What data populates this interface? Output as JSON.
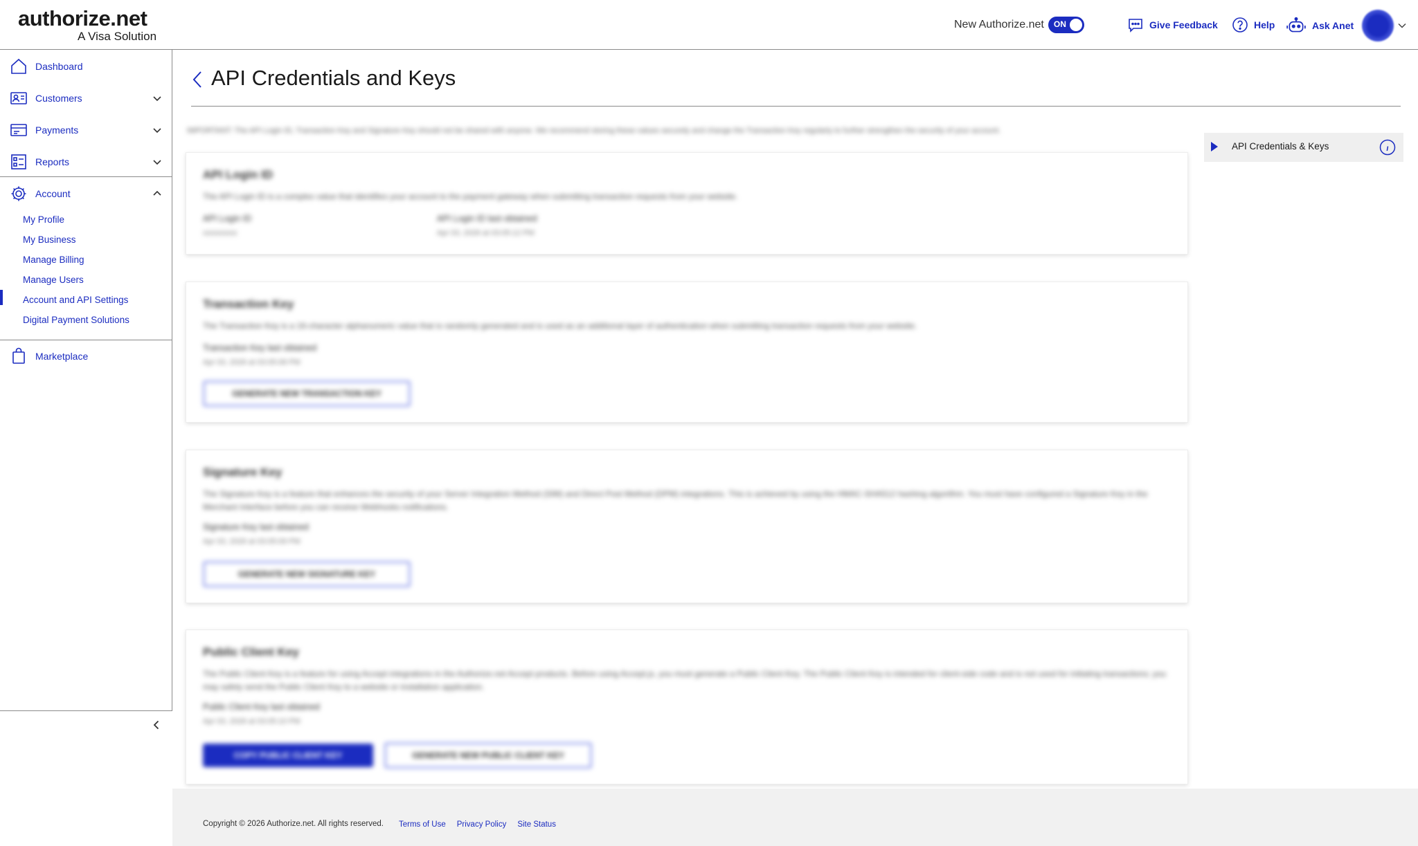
{
  "header": {
    "logo": "authorize.net",
    "logo_tagline": "A Visa Solution",
    "toggle_label": "New Authorize.net",
    "toggle_state": "ON",
    "give_feedback": "Give Feedback",
    "help": "Help",
    "ask_anet": "Ask Anet"
  },
  "sidebar": {
    "items": [
      {
        "label": "Dashboard",
        "icon": "home-icon"
      },
      {
        "label": "Customers",
        "icon": "customers-icon"
      },
      {
        "label": "Payments",
        "icon": "card-icon"
      },
      {
        "label": "Reports",
        "icon": "reports-icon"
      },
      {
        "label": "Account",
        "icon": "gear-icon"
      },
      {
        "label": "Marketplace",
        "icon": "bag-icon"
      }
    ],
    "account_sub": [
      "My Profile",
      "My Business",
      "Manage Billing",
      "Manage Users",
      "Account and API Settings",
      "Digital Payment Solutions"
    ],
    "active_sub": "Account and API Settings"
  },
  "page": {
    "title": "API Credentials and Keys",
    "notice": "IMPORTANT: The API Login ID, Transaction Key and Signature Key should not be shared with anyone. We recommend storing these values securely and change the Transaction Key regularly to further strengthen the security of your account.",
    "cards": [
      {
        "title": "API Login ID",
        "desc": "The API Login ID is a complex value that identifies your account to the payment gateway when submitting transaction requests from your website.",
        "label1": "API Login ID",
        "value1": "xxxxxxxxx",
        "label2": "API Login ID last obtained",
        "value2": "Apr 03, 2026 at 03:05:12 PM"
      },
      {
        "title": "Transaction Key",
        "desc": "The Transaction Key is a 16-character alphanumeric value that is randomly generated and is used as an additional layer of authentication when submitting transaction requests from your website.",
        "label1": "Transaction Key last obtained",
        "value1": "Apr 03, 2026 at 03:05:08 PM",
        "button": "GENERATE NEW TRANSACTION KEY"
      },
      {
        "title": "Signature Key",
        "desc": "The Signature Key is a feature that enhances the security of your Server Integration Method (SIM) and Direct Post Method (DPM) integrations. This is achieved by using the HMAC-SHA512 hashing algorithm. You must have configured a Signature Key in the Merchant Interface before you can receive Webhooks notifications.",
        "label1": "Signature Key last obtained",
        "value1": "Apr 03, 2026 at 03:05:09 PM",
        "button": "GENERATE NEW SIGNATURE KEY"
      },
      {
        "title": "Public Client Key",
        "desc": "The Public Client Key is a feature for using Accept integrations in the Authorize.net Accept products. Before using Accept.js, you must generate a Public Client Key. The Public Client Key is intended for client-side code and is not used for initiating transactions; you may safely send the Public Client Key to a website or installation application.",
        "label1": "Public Client Key last obtained",
        "value1": "Apr 03, 2026 at 03:05:10 PM",
        "button_primary": "COPY PUBLIC CLIENT KEY",
        "button": "GENERATE NEW PUBLIC CLIENT KEY"
      }
    ]
  },
  "rail": {
    "label": "API Credentials & Keys"
  },
  "footer": {
    "copyright": "Copyright © 2026 Authorize.net. All rights reserved.",
    "links": [
      "Terms of Use",
      "Privacy Policy",
      "Site Status"
    ]
  },
  "colors": {
    "accent": "#1b2cc0",
    "border": "#8a8a8a",
    "rail_bg": "#efefef",
    "footer_bg": "#f1f1f1"
  }
}
